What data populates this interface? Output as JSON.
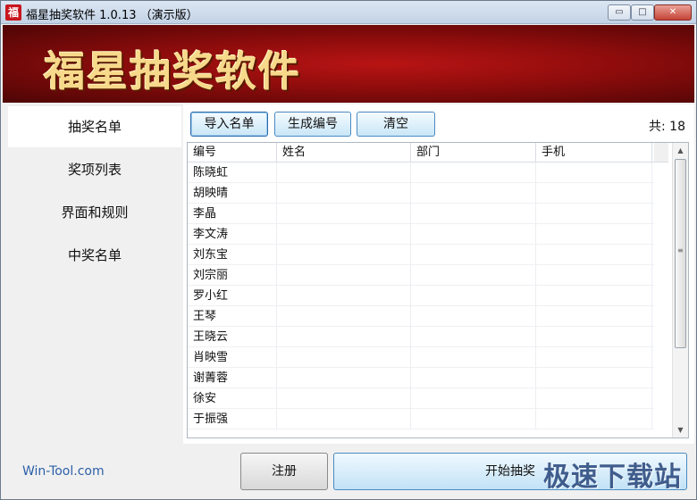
{
  "window": {
    "title": "福星抽奖软件 1.0.13 （演示版）",
    "icon_char": "福",
    "minimize_glyph": "▭",
    "maximize_glyph": "□",
    "close_glyph": "✕"
  },
  "banner": {
    "title": "福星抽奖软件"
  },
  "sidebar": {
    "items": [
      {
        "label": "抽奖名单",
        "active": true
      },
      {
        "label": "奖项列表",
        "active": false
      },
      {
        "label": "界面和规则",
        "active": false
      },
      {
        "label": "中奖名单",
        "active": false
      }
    ]
  },
  "toolbar": {
    "import_label": "导入名单",
    "generate_label": "生成编号",
    "clear_label": "清空",
    "count_text": "共: 18"
  },
  "table": {
    "columns": [
      "编号",
      "姓名",
      "部门",
      "手机"
    ],
    "rows": [
      [
        "陈晓虹",
        "",
        "",
        ""
      ],
      [
        "胡映晴",
        "",
        "",
        ""
      ],
      [
        "李晶",
        "",
        "",
        ""
      ],
      [
        "李文涛",
        "",
        "",
        ""
      ],
      [
        "刘东宝",
        "",
        "",
        ""
      ],
      [
        "刘宗丽",
        "",
        "",
        ""
      ],
      [
        "罗小红",
        "",
        "",
        ""
      ],
      [
        "王琴",
        "",
        "",
        ""
      ],
      [
        "王晓云",
        "",
        "",
        ""
      ],
      [
        "肖映雪",
        "",
        "",
        ""
      ],
      [
        "谢菁蓉",
        "",
        "",
        ""
      ],
      [
        "徐安",
        "",
        "",
        ""
      ],
      [
        "于振强",
        "",
        "",
        ""
      ]
    ],
    "scroll_position": 0.0
  },
  "footer": {
    "brand": "Win-Tool.com",
    "register_label": "注册",
    "start_label": "开始抽奖",
    "watermark": "极速下载站"
  }
}
